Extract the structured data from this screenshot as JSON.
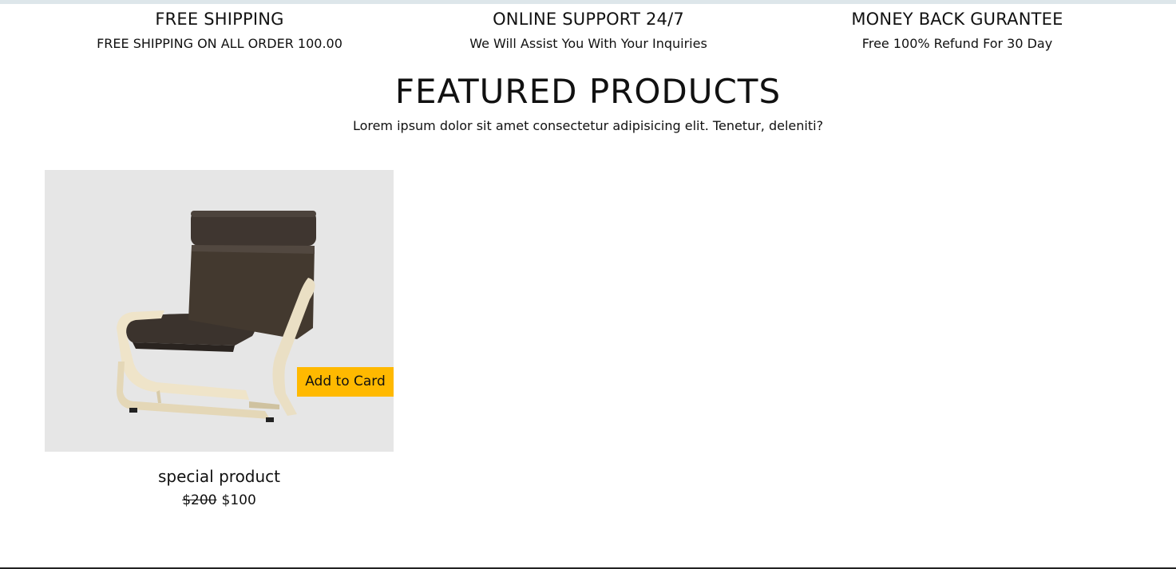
{
  "services": [
    {
      "title": "FREE SHIPPING",
      "description": "FREE SHIPPING ON ALL ORDER 100.00"
    },
    {
      "title": "ONLINE SUPPORT 24/7",
      "description": "We Will Assist You With Your Inquiries"
    },
    {
      "title": "MONEY BACK GURANTEE",
      "description": "Free 100% Refund For 30 Day"
    }
  ],
  "featured": {
    "title": "FEATURED PRODUCTS",
    "subtitle": "Lorem ipsum dolor sit amet consectetur adipisicing elit. Tenetur, deleniti?"
  },
  "products": [
    {
      "image": "armchair",
      "button_label": "Add to Card",
      "name": "special product",
      "old_price": "$200",
      "price": "$100"
    }
  ],
  "colors": {
    "button_accent": "#ffb900",
    "card_background": "#e6e6e6",
    "top_strip": "#dde6ea",
    "text": "#111111"
  }
}
